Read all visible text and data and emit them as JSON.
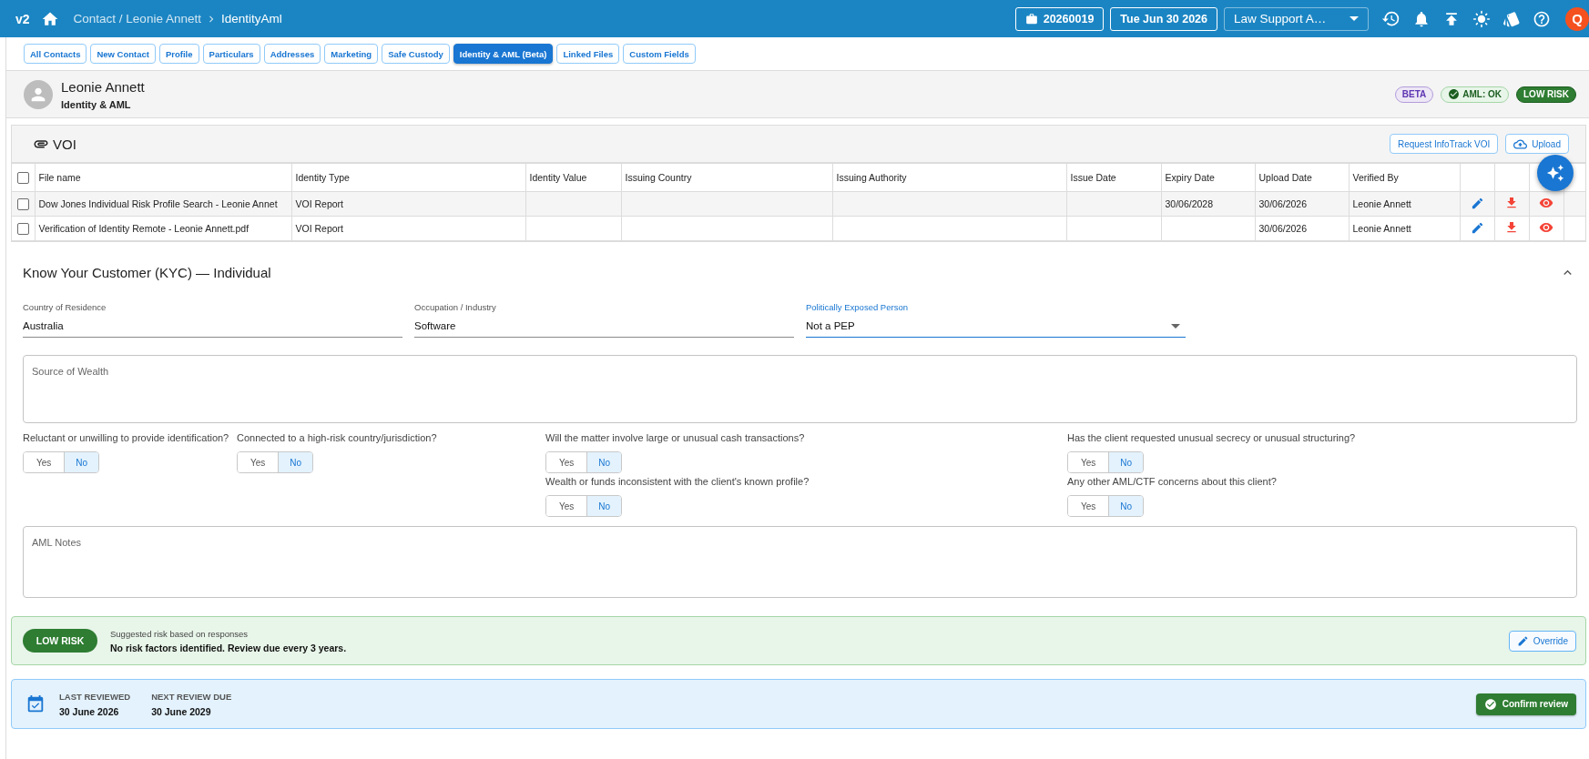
{
  "top_bar": {
    "version": "v2",
    "breadcrumb": {
      "path": "Contact / Leonie Annett",
      "current": "IdentityAml"
    },
    "matter": "20260019",
    "date": "Tue Jun 30 2026",
    "workspace": "Law Support A…",
    "avatar": "Q"
  },
  "tabs": [
    {
      "label": "All Contacts",
      "selected": false
    },
    {
      "label": "New Contact",
      "selected": false
    },
    {
      "label": "Profile",
      "selected": false
    },
    {
      "label": "Particulars",
      "selected": false
    },
    {
      "label": "Addresses",
      "selected": false
    },
    {
      "label": "Marketing",
      "selected": false
    },
    {
      "label": "Safe Custody",
      "selected": false
    },
    {
      "label": "Identity & AML (Beta)",
      "selected": true
    },
    {
      "label": "Linked Files",
      "selected": false
    },
    {
      "label": "Custom Fields",
      "selected": false
    }
  ],
  "contact_header": {
    "name": "Leonie Annett",
    "subtitle": "Identity & AML",
    "badges": [
      {
        "label": "BETA",
        "kind": "beta"
      },
      {
        "label": "AML: OK",
        "kind": "check"
      },
      {
        "label": "LOW RISK",
        "kind": "risk_low"
      }
    ]
  },
  "voi": {
    "title": "VOI",
    "actions": [
      {
        "label": "Request InfoTrack VOI",
        "kind": "text"
      },
      {
        "label": "Upload",
        "kind": "upload"
      }
    ],
    "table": {
      "header_checkbox": {
        "checked": false
      },
      "columns": [
        "File name",
        "Identity Type",
        "Identity Value",
        "Issuing Country",
        "Issuing Authority",
        "Issue Date",
        "Expiry Date",
        "Upload Date",
        "Verified By"
      ],
      "rows": [
        {
          "checked": false,
          "cells": [
            "Dow Jones Individual Risk Profile Search - Leonie Annet",
            "VOI Report",
            null,
            null,
            null,
            null,
            "30/06/2028",
            "30/06/2026",
            "Leonie Annett"
          ]
        },
        {
          "checked": false,
          "cells": [
            "Verification of Identity Remote - Leonie Annett.pdf",
            "VOI Report",
            null,
            null,
            null,
            null,
            null,
            "30/06/2026",
            "Leonie Annett"
          ]
        }
      ]
    }
  },
  "kyc": {
    "title": "Know Your Customer (KYC) — Individual",
    "expanded": true,
    "fields": [
      {
        "label": "Country of Residence",
        "value": "Australia",
        "kind": "text",
        "focused": false
      },
      {
        "label": "Occupation / Industry",
        "value": "Software",
        "kind": "text",
        "focused": false
      },
      {
        "label": "Politically Exposed Person",
        "value": "Not a PEP",
        "kind": "select",
        "focused": true
      }
    ],
    "source_of_wealth": {
      "placeholder": "Source of Wealth"
    },
    "question_columns": [
      {
        "questions": [
          {
            "text": "Reluctant or unwilling to provide identification?",
            "options": [
              {
                "label": "Yes",
                "selected": false
              },
              {
                "label": "No",
                "selected": true
              }
            ]
          }
        ]
      },
      {
        "questions": [
          {
            "text": "Connected to a high-risk country/jurisdiction?",
            "options": [
              {
                "label": "Yes",
                "selected": false
              },
              {
                "label": "No",
                "selected": true
              }
            ]
          }
        ]
      },
      {
        "questions": [
          {
            "text": "Will the matter involve large or unusual cash transactions?",
            "options": [
              {
                "label": "Yes",
                "selected": false
              },
              {
                "label": "No",
                "selected": true
              }
            ]
          },
          {
            "text": "Wealth or funds inconsistent with the client's known profile?",
            "options": [
              {
                "label": "Yes",
                "selected": false
              },
              {
                "label": "No",
                "selected": true
              }
            ]
          }
        ]
      },
      {
        "questions": [
          {
            "text": "Has the client requested unusual secrecy or unusual structuring?",
            "options": [
              {
                "label": "Yes",
                "selected": false
              },
              {
                "label": "No",
                "selected": true
              }
            ]
          },
          {
            "text": "Any other AML/CTF concerns about this client?",
            "options": [
              {
                "label": "Yes",
                "selected": false
              },
              {
                "label": "No",
                "selected": true
              }
            ]
          }
        ]
      }
    ],
    "aml_notes": {
      "placeholder": "AML Notes"
    }
  },
  "risk_summary": {
    "risk": {
      "label": "LOW RISK",
      "kind": "low"
    },
    "caption": "Suggested risk based on responses",
    "summary": "No risk factors identified. Review due every 3 years.",
    "action": "Override"
  },
  "review": {
    "items": [
      {
        "label": "LAST REVIEWED",
        "value": "30 June 2026"
      },
      {
        "label": "NEXT REVIEW DUE",
        "value": "30 June 2029"
      }
    ],
    "action": "Confirm review"
  }
}
